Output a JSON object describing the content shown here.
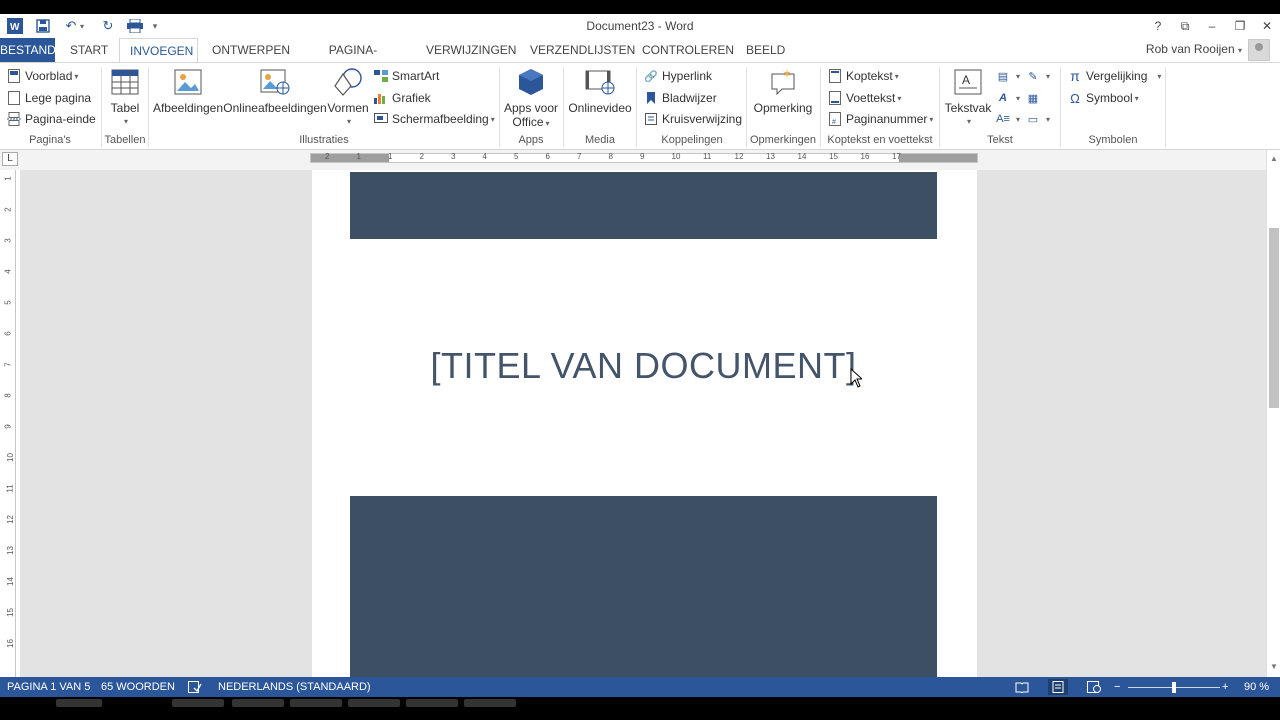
{
  "window": {
    "title": "Document23 - Word",
    "controls": {
      "help": "?",
      "ribbon_display": "⧉",
      "minimize": "–",
      "restore": "❐",
      "close": "✕"
    }
  },
  "quick_access": {
    "more": "▾"
  },
  "tabs": [
    {
      "label": "BESTAND"
    },
    {
      "label": "START"
    },
    {
      "label": "INVOEGEN"
    },
    {
      "label": "ONTWERPEN"
    },
    {
      "label": "PAGINA-INDELING"
    },
    {
      "label": "VERWIJZINGEN"
    },
    {
      "label": "VERZENDLIJSTEN"
    },
    {
      "label": "CONTROLEREN"
    },
    {
      "label": "BEELD"
    }
  ],
  "user": {
    "name": "Rob van Rooijen",
    "menu": "▾"
  },
  "ribbon": {
    "paginas": {
      "voorblad": "Voorblad",
      "lege_pagina": "Lege pagina",
      "pagina_einde": "Pagina-einde",
      "label": "Pagina's"
    },
    "tabellen": {
      "tabel": "Tabel",
      "label": "Tabellen"
    },
    "illustraties": {
      "afbeeldingen": "Afbeeldingen",
      "online": "Onlineafbeeldingen",
      "vormen": "Vormen",
      "smartart": "SmartArt",
      "grafiek": "Grafiek",
      "schermafbeelding": "Schermafbeelding",
      "label": "Illustraties"
    },
    "apps": {
      "apps_line1": "Apps voor",
      "apps_line2": "Office",
      "label": "Apps"
    },
    "media": {
      "onlinevideo": "Onlinevideo",
      "label": "Media"
    },
    "koppelingen": {
      "hyperlink": "Hyperlink",
      "bladwijzer": "Bladwijzer",
      "kruisverwijzing": "Kruisverwijzing",
      "label": "Koppelingen"
    },
    "opmerkingen": {
      "opmerking": "Opmerking",
      "label": "Opmerkingen"
    },
    "koptekst": {
      "koptekst": "Koptekst",
      "voettekst": "Voettekst",
      "paginanummer": "Paginanummer",
      "label": "Koptekst en voettekst"
    },
    "tekst": {
      "tekstvak": "Tekstvak",
      "label": "Tekst"
    },
    "symbolen": {
      "vergelijking": "Vergelijking",
      "symbool": "Symbool",
      "label": "Symbolen"
    }
  },
  "ruler": {
    "tab_selector": "L",
    "h_numbers": [
      "2",
      "1",
      "1",
      "2",
      "3",
      "4",
      "5",
      "6",
      "7",
      "8",
      "9",
      "10",
      "11",
      "12",
      "13",
      "14",
      "15",
      "16",
      "17"
    ],
    "v_numbers": [
      "1",
      "2",
      "3",
      "4",
      "5",
      "6",
      "7",
      "8",
      "9",
      "10",
      "11",
      "12",
      "13",
      "14",
      "15",
      "16"
    ]
  },
  "document": {
    "title_placeholder": "[TITEL VAN DOCUMENT]",
    "band_color": "#3d4f63",
    "title_color": "#44546a"
  },
  "statusbar": {
    "page": "PAGINA 1 VAN 5",
    "words": "65 WOORDEN",
    "language": "NEDERLANDS (STANDAARD)",
    "zoom_minus": "−",
    "zoom_plus": "+",
    "zoom": "90 %",
    "zoom_level": 0.5
  },
  "colors": {
    "accent": "#2b579a"
  }
}
